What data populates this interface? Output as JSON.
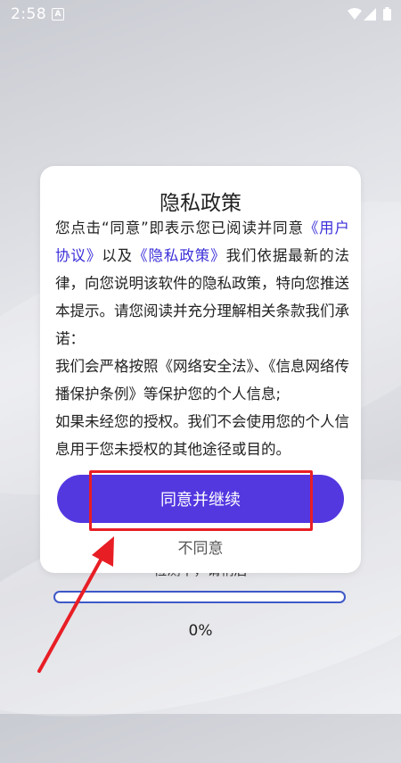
{
  "status_bar": {
    "time": "2:58",
    "notification_glyph": "A",
    "icons": [
      "wifi-icon",
      "signal-icon",
      "battery-icon"
    ]
  },
  "background": {
    "progress_label": "检测中，请稍后",
    "progress_value": 0,
    "progress_percent": "0%"
  },
  "dialog": {
    "title": "隐私政策",
    "paragraph1": {
      "prefix": "您点击“同意”即表示您已阅读并同意",
      "link1": "《用户协议》",
      "middle": "以及",
      "link2": "《隐私政策》",
      "suffix": "我们依据最新的法律，向您说明该软件的隐私政策，特向您推送本提示。请您阅读并充分理解相关条款我们承诺："
    },
    "paragraph2": "我们会严格按照《网络安全法》、《信息网络传播保护条例》等保护您的个人信息;",
    "paragraph3": "如果未经您的授权。我们不会使用您的个人信息用于您未授权的其他途径或目的。",
    "agree_label": "同意并继续",
    "disagree_label": "不同意"
  },
  "colors": {
    "accent": "#5338e0",
    "link": "#3b2fd9",
    "annotation": "#e81e25",
    "progress": "#3e58c8"
  }
}
